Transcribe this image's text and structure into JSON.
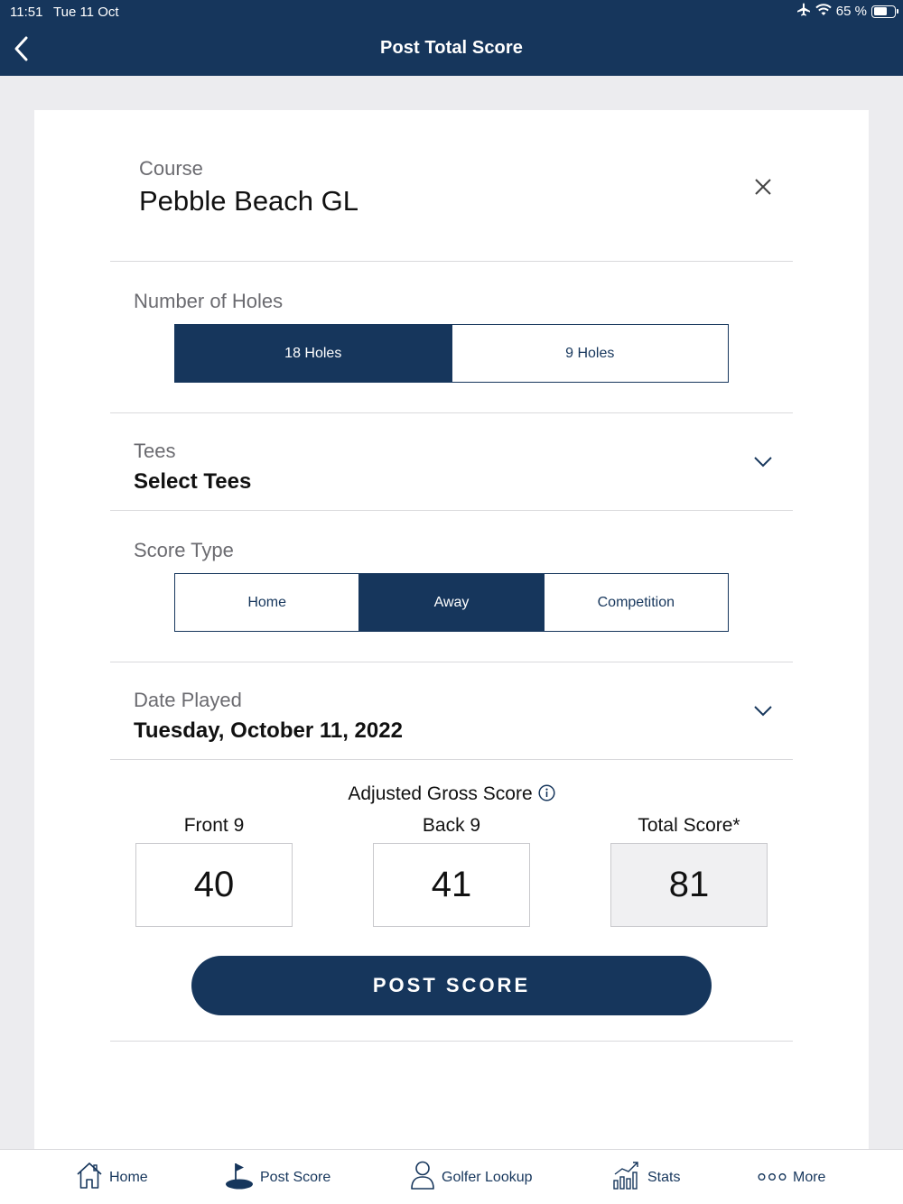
{
  "status": {
    "time": "11:51",
    "date": "Tue 11 Oct",
    "battery": "65 %",
    "battery_level": 0.65
  },
  "header": {
    "title": "Post Total Score"
  },
  "course": {
    "label": "Course",
    "value": "Pebble Beach GL"
  },
  "holes": {
    "label": "Number of Holes",
    "options": [
      "18 Holes",
      "9 Holes"
    ],
    "selected": "18 Holes"
  },
  "tees": {
    "label": "Tees",
    "value": "Select Tees"
  },
  "score_type": {
    "label": "Score Type",
    "options": [
      "Home",
      "Away",
      "Competition"
    ],
    "selected": "Away"
  },
  "date_played": {
    "label": "Date Played",
    "value": "Tuesday, October 11, 2022"
  },
  "adjusted_gross": {
    "title": "Adjusted Gross Score",
    "front_label": "Front 9",
    "back_label": "Back 9",
    "total_label": "Total Score*",
    "front_value": "40",
    "back_value": "41",
    "total_value": "81"
  },
  "post_button": "POST SCORE",
  "tabs": [
    {
      "label": "Home",
      "icon": "house-icon"
    },
    {
      "label": "Post Score",
      "icon": "golf-flag-icon"
    },
    {
      "label": "Golfer Lookup",
      "icon": "person-icon"
    },
    {
      "label": "Stats",
      "icon": "chart-icon"
    },
    {
      "label": "More",
      "icon": "more-dots-icon"
    }
  ],
  "colors": {
    "brand_navy": "#16365c",
    "background": "#ececef",
    "divider": "#d9d9dc"
  }
}
